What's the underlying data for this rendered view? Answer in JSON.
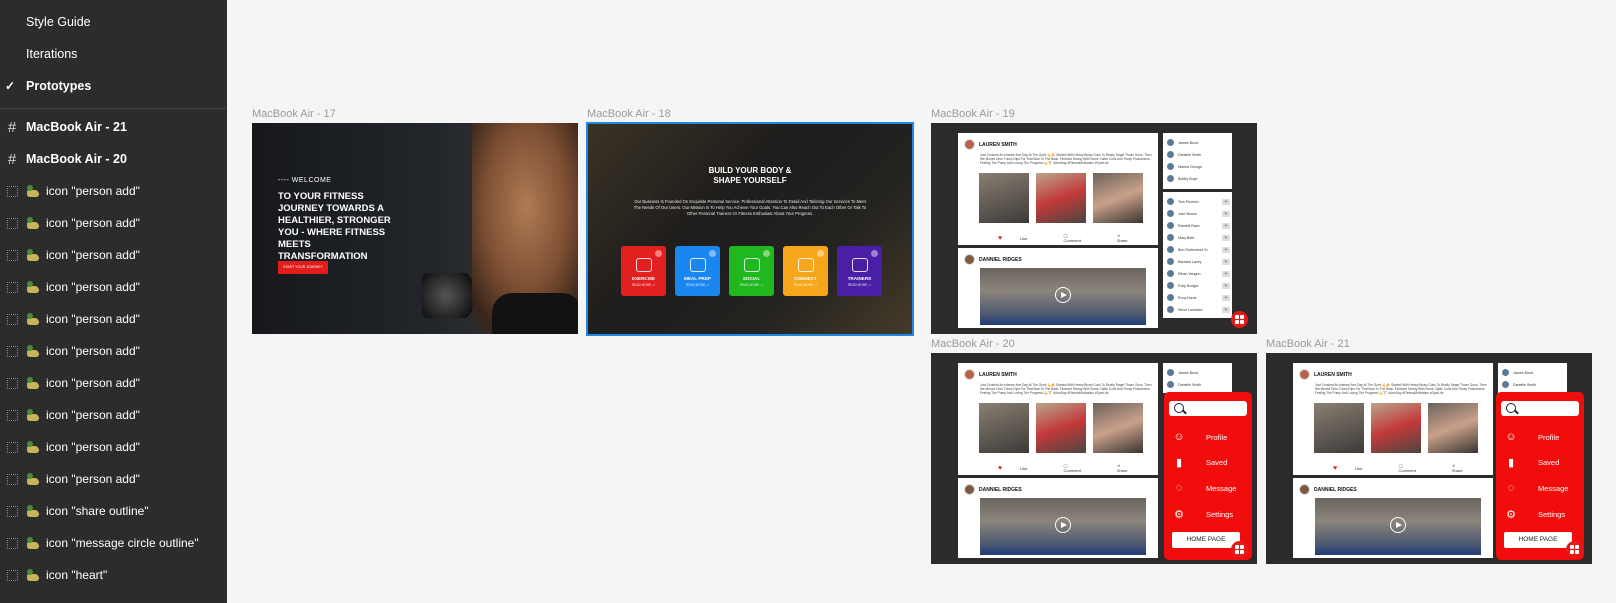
{
  "sidebar": {
    "pages": [
      {
        "label": "Style Guide",
        "active": false
      },
      {
        "label": "Iterations",
        "active": false
      },
      {
        "label": "Prototypes",
        "active": true
      }
    ],
    "layers": [
      {
        "type": "frame",
        "label": "MacBook Air - 21"
      },
      {
        "type": "frame",
        "label": "MacBook Air - 20"
      },
      {
        "type": "component",
        "label": "icon \"person add\""
      },
      {
        "type": "component",
        "label": "icon \"person add\""
      },
      {
        "type": "component",
        "label": "icon \"person add\""
      },
      {
        "type": "component",
        "label": "icon \"person add\""
      },
      {
        "type": "component",
        "label": "icon \"person add\""
      },
      {
        "type": "component",
        "label": "icon \"person add\""
      },
      {
        "type": "component",
        "label": "icon \"person add\""
      },
      {
        "type": "component",
        "label": "icon \"person add\""
      },
      {
        "type": "component",
        "label": "icon \"person add\""
      },
      {
        "type": "component",
        "label": "icon \"person add\""
      },
      {
        "type": "component",
        "label": "icon \"share outline\""
      },
      {
        "type": "component",
        "label": "icon \"message circle outline\""
      },
      {
        "type": "component",
        "label": "icon \"heart\""
      }
    ]
  },
  "frames": {
    "f17": {
      "label": "MacBook Air - 17",
      "welcome": "---- WELCOME",
      "headline": "TO YOUR FITNESS JOURNEY TOWARDS A HEALTHIER, STRONGER YOU - WHERE FITNESS MEETS TRANSFORMATION",
      "cta": "START YOUR JOURNEY"
    },
    "f18": {
      "label": "MacBook Air - 18",
      "title_line1": "BUILD YOUR BODY &",
      "title_line2": "SHAPE YOURSELF",
      "paragraph": "Our Business Is Founded On Exquisite Personal Service, Professional Attention To Detail And Tailoring Our Services To Meet The Needs Of Our Users. Our Mission Is To Help You Achieve Your Goals. You Can Also Reach Out To Each Other Or Talk To Other Personal Trainers Or Fitness Enthusiast About Your Progress.",
      "cards": [
        {
          "name": "EXERCISE",
          "more": "READ MORE ->",
          "color": "#e32020"
        },
        {
          "name": "MEAL PREP",
          "more": "READ MORE ->",
          "color": "#1a86f0"
        },
        {
          "name": "SOCIAL",
          "more": "READ MORE ->",
          "color": "#1fb81f"
        },
        {
          "name": "CONNECT",
          "more": "READ MORE ->",
          "color": "#f6a61b"
        },
        {
          "name": "TRAINERS",
          "more": "READ MORE ->",
          "color": "#4a1fa6"
        }
      ]
    },
    "f19": {
      "label": "MacBook Air - 19"
    },
    "f20": {
      "label": "MacBook Air - 20"
    },
    "f21": {
      "label": "MacBook Air - 21"
    }
  },
  "social": {
    "post1_author": "LAUREN SMITH",
    "post1_text": "Just Crushed An Intense Arm Day At The Gym! 💪🔥 Started With Heavy Bicep Curls To Really Target Those Guns. Then We Moved Onto Tricep Dips For That Burn In The Back. Finished Strong With Some Cable Curls And Tricep Pushdowns. Feeling The Pump And Loving The Progress! 💪🏋️ #ArmDay #FitnessMotivation #GymLife",
    "like": "Like",
    "comment": "Comment",
    "share": "Share",
    "post2_author": "DANNIEL RIDGES",
    "friends": [
      "James Bond",
      "Danielle Smith",
      "Marina George",
      "Bobby Boyd"
    ],
    "suggestions": [
      "Tom Phoenix",
      "Josh Brown",
      "Ramthil Raxe",
      "Mary Beth",
      "Ben Rothenford Sr",
      "Barbara Lacey",
      "Ethan Vaughn",
      "Polly Rodger",
      "Rony Davis",
      "Steve Lombard"
    ],
    "menu": {
      "items": [
        {
          "icon": "person-check-icon",
          "label": "Profile"
        },
        {
          "icon": "bookmark-icon",
          "label": "Saved"
        },
        {
          "icon": "message-icon",
          "label": "Message"
        },
        {
          "icon": "gear-icon",
          "label": "Settings"
        }
      ],
      "home": "HOME PAGE"
    }
  }
}
